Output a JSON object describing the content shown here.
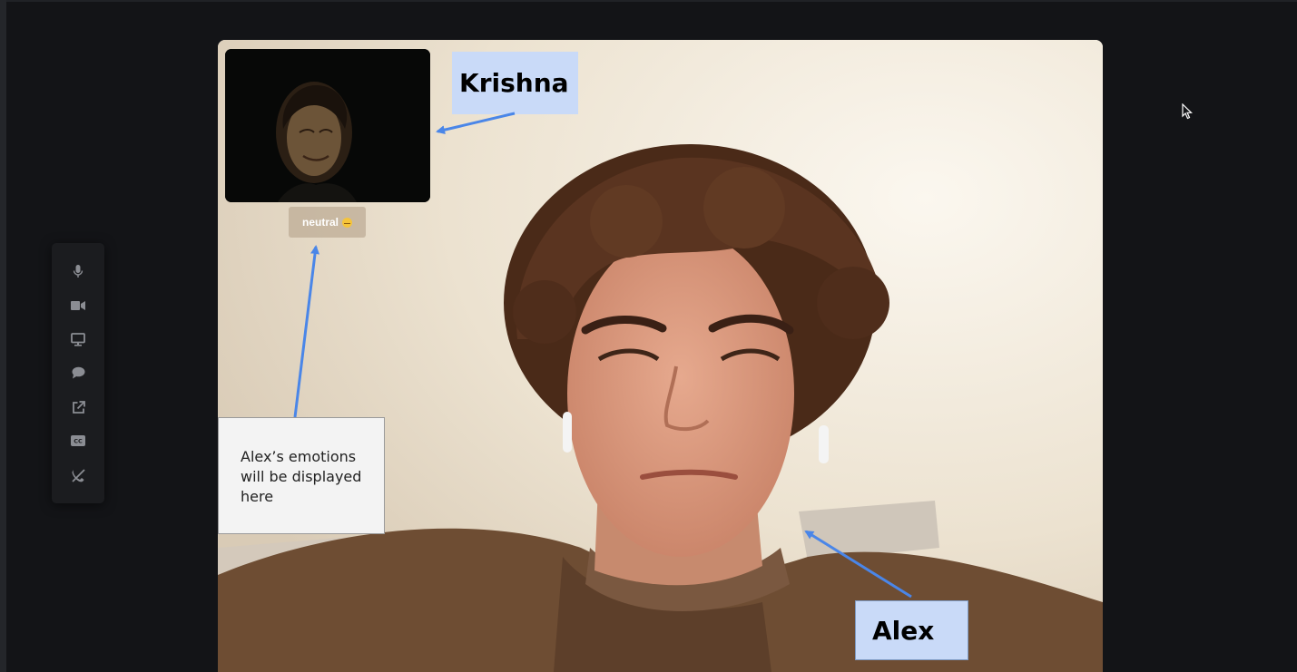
{
  "annotations": {
    "krishna_label": "Krishna",
    "alex_label": "Alex",
    "emotion_note": "Alex’s emotions will be displayed here"
  },
  "self_view": {
    "emotion": "neutral",
    "emotion_icon": "neutral-face-emoji"
  },
  "toolbar": {
    "items": [
      {
        "icon": "microphone-icon"
      },
      {
        "icon": "video-camera-icon"
      },
      {
        "icon": "screen-share-icon"
      },
      {
        "icon": "chat-icon"
      },
      {
        "icon": "popout-icon"
      },
      {
        "icon": "closed-captions-icon"
      },
      {
        "icon": "end-call-icon"
      }
    ]
  },
  "colors": {
    "background": "#131417",
    "annotation_fill": "#c9daf8",
    "arrow": "#4a86e8"
  }
}
